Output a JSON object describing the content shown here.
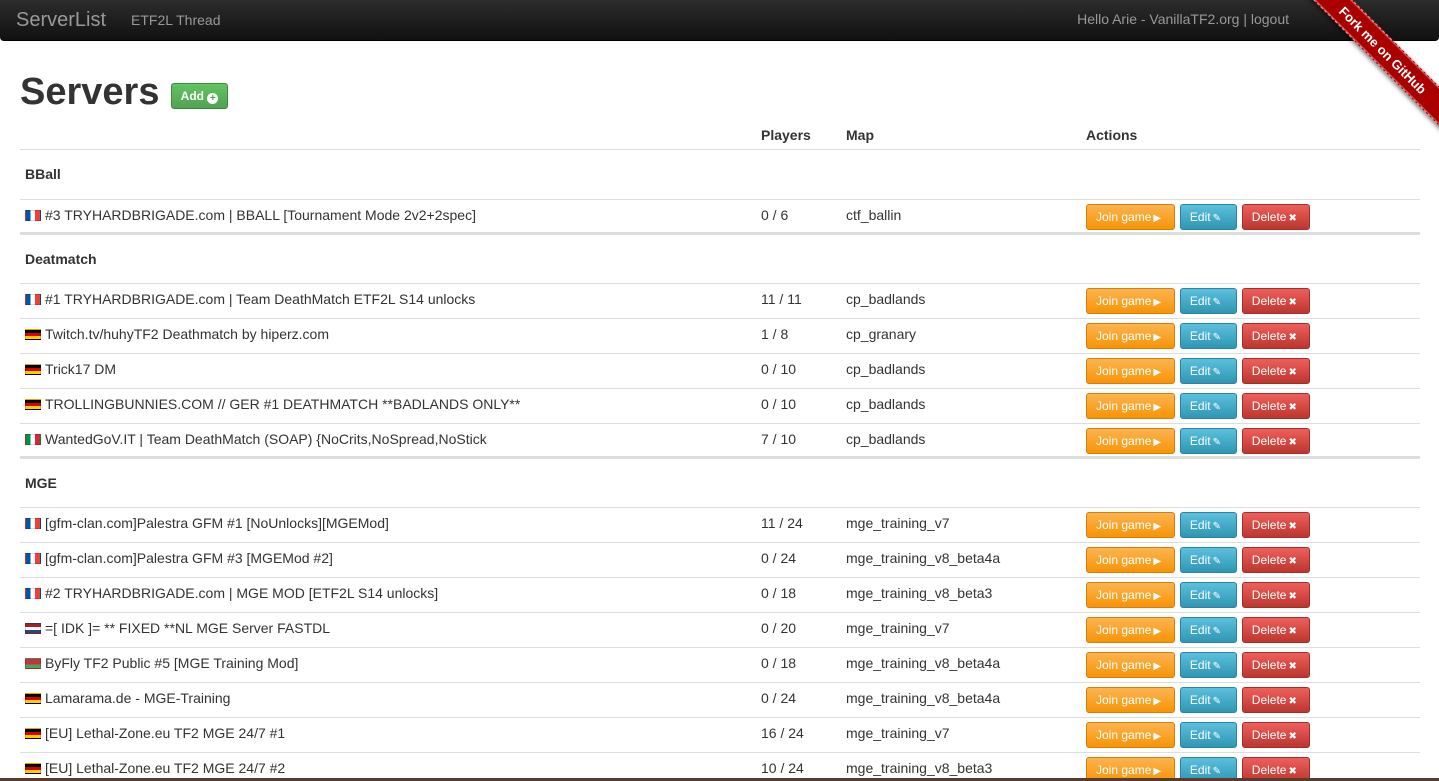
{
  "navbar": {
    "brand": "ServerList",
    "link": "ETF2L Thread",
    "user_text": "Hello Arie - VanillaTF2.org | logout",
    "ribbon": "Fork me on GitHub"
  },
  "page": {
    "title": "Servers",
    "add_label": "Add"
  },
  "table": {
    "headers": {
      "players": "Players",
      "map": "Map",
      "actions": "Actions"
    },
    "buttons": {
      "join": "Join game",
      "edit": "Edit",
      "delete": "Delete"
    },
    "groups": [
      {
        "name": "BBall",
        "rows": [
          {
            "flag": "fr",
            "name": "#3 TRYHARDBRIGADE.com | BBALL [Tournament Mode 2v2+2spec]",
            "players": "0 / 6",
            "map": "ctf_ballin"
          }
        ]
      },
      {
        "name": "Deatmatch",
        "rows": [
          {
            "flag": "fr",
            "name": "#1 TRYHARDBRIGADE.com | Team DeathMatch ETF2L S14 unlocks",
            "players": "11 / 11",
            "map": "cp_badlands"
          },
          {
            "flag": "de",
            "name": "Twitch.tv/huhyTF2 Deathmatch by hiperz.com",
            "players": "1 / 8",
            "map": "cp_granary"
          },
          {
            "flag": "de",
            "name": "Trick17 DM",
            "players": "0 / 10",
            "map": "cp_badlands"
          },
          {
            "flag": "de",
            "name": "TROLLINGBUNNIES.COM // GER #1 DEATHMATCH **BADLANDS ONLY**",
            "players": "0 / 10",
            "map": "cp_badlands"
          },
          {
            "flag": "it",
            "name": "WantedGoV.IT | Team DeathMatch (SOAP) {NoCrits,NoSpread,NoStick",
            "players": "7 / 10",
            "map": "cp_badlands"
          }
        ]
      },
      {
        "name": "MGE",
        "rows": [
          {
            "flag": "fr",
            "name": "[gfm-clan.com]Palestra GFM #1 [NoUnlocks][MGEMod]",
            "players": "11 / 24",
            "map": "mge_training_v7"
          },
          {
            "flag": "fr",
            "name": "[gfm-clan.com]Palestra GFM #3 [MGEMod #2]",
            "players": "0 / 24",
            "map": "mge_training_v8_beta4a"
          },
          {
            "flag": "fr",
            "name": "#2 TRYHARDBRIGADE.com | MGE MOD [ETF2L S14 unlocks]",
            "players": "0 / 18",
            "map": "mge_training_v8_beta3"
          },
          {
            "flag": "nl",
            "name": "=[ IDK ]= ** FIXED **NL MGE Server FASTDL",
            "players": "0 / 20",
            "map": "mge_training_v7"
          },
          {
            "flag": "by",
            "name": "ByFly TF2 Public #5 [MGE Training Mod]",
            "players": "0 / 18",
            "map": "mge_training_v8_beta4a"
          },
          {
            "flag": "de",
            "name": "Lamarama.de - MGE-Training",
            "players": "0 / 24",
            "map": "mge_training_v8_beta4a"
          },
          {
            "flag": "de",
            "name": "[EU] Lethal-Zone.eu TF2 MGE 24/7 #1",
            "players": "16 / 24",
            "map": "mge_training_v7"
          },
          {
            "flag": "de",
            "name": "[EU] Lethal-Zone.eu TF2 MGE 24/7 #2",
            "players": "10 / 24",
            "map": "mge_training_v8_beta3"
          }
        ]
      }
    ]
  }
}
